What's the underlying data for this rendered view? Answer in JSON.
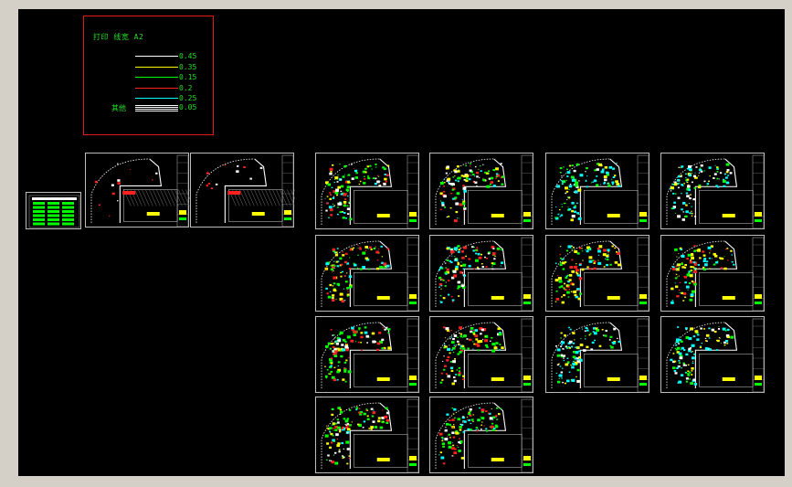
{
  "legend": {
    "title": "打印 线宽   A2",
    "rows": [
      {
        "value": "0.45",
        "color": "#ffffff"
      },
      {
        "value": "0.35",
        "color": "#ffff00"
      },
      {
        "value": "0.15",
        "color": "#00ff00"
      },
      {
        "value": "0.2",
        "color": "#ff2020"
      },
      {
        "value": "0.25",
        "color": "#00ffff"
      }
    ],
    "hatch_row": {
      "label": "其他",
      "value": "0.05",
      "color": "#ffffff"
    }
  },
  "colors": {
    "workspace": "#d4d0c8",
    "model_space": "#000000",
    "frame_border": "#bdbdbd",
    "legend_border": "#e21b1b"
  }
}
